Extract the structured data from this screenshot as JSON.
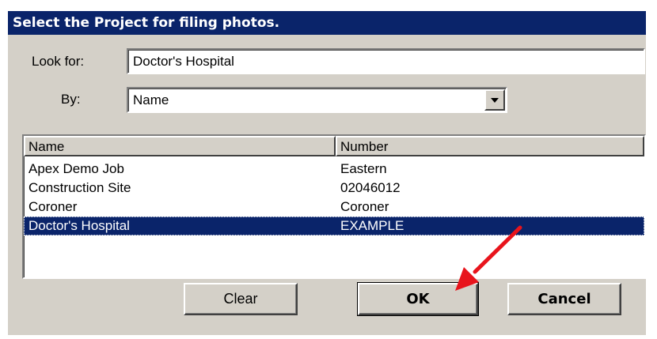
{
  "dialog": {
    "title": "Select the Project for filing photos."
  },
  "search": {
    "look_for_label": "Look for:",
    "look_for_value": "Doctor's Hospital",
    "by_label": "By:",
    "by_value": "Name"
  },
  "list": {
    "columns": [
      "Name",
      "Number"
    ],
    "rows": [
      {
        "name": "Apex Demo Job",
        "number": "Eastern"
      },
      {
        "name": "Construction Site",
        "number": "02046012"
      },
      {
        "name": "Coroner",
        "number": "Coroner"
      },
      {
        "name": "Doctor's Hospital",
        "number": "EXAMPLE"
      }
    ],
    "selected_index": 3
  },
  "buttons": {
    "clear": "Clear",
    "ok": "OK",
    "cancel": "Cancel"
  },
  "icons": {
    "dropdown": "chevron-down-icon",
    "annotation": "red-arrow-icon"
  },
  "colors": {
    "titlebar": "#0a246a",
    "selection": "#0a246a",
    "face": "#d4d0c8",
    "annotation_arrow": "#e8141c"
  }
}
